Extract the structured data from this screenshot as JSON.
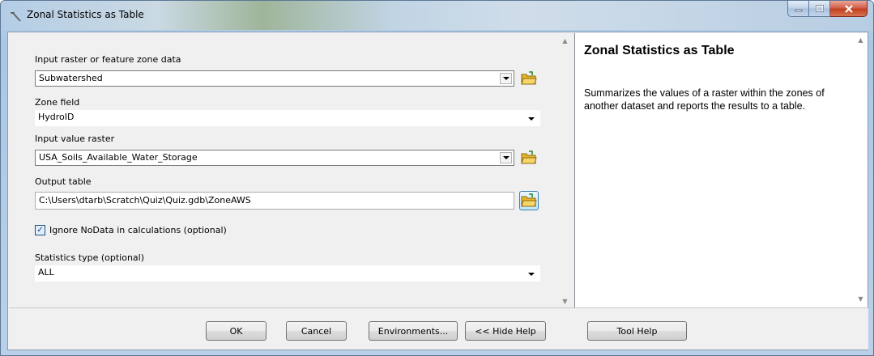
{
  "window": {
    "title": "Zonal Statistics as Table"
  },
  "form": {
    "input_zone": {
      "label": "Input raster or feature zone data",
      "value": "Subwatershed"
    },
    "zone_field": {
      "label": "Zone field",
      "value": "HydroID"
    },
    "value_raster": {
      "label": "Input value raster",
      "value": "USA_Soils_Available_Water_Storage"
    },
    "output_table": {
      "label": "Output table",
      "value": "C:\\Users\\dtarb\\Scratch\\Quiz\\Quiz.gdb\\ZoneAWS"
    },
    "ignore_nodata": {
      "label": "Ignore NoData in calculations (optional)",
      "checked": true,
      "check_glyph": "✓"
    },
    "statistics_type": {
      "label": "Statistics type (optional)",
      "value": "ALL"
    }
  },
  "help": {
    "title": "Zonal Statistics as Table",
    "description": "Summarizes the values of a raster within the zones of another dataset and reports the results to a table."
  },
  "buttons": {
    "ok": "OK",
    "cancel": "Cancel",
    "environments": "Environments...",
    "hide_help": "<< Hide Help",
    "tool_help": "Tool Help"
  },
  "icons": {
    "window_icon": "hammer-icon",
    "browse": "open-folder-icon",
    "dropdown": "chevron-down-icon"
  },
  "colors": {
    "title_bar": "#b4cde6",
    "close_button": "#c1401f",
    "dialog_background": "#f0f0f0",
    "folder": "#e6b52b"
  }
}
